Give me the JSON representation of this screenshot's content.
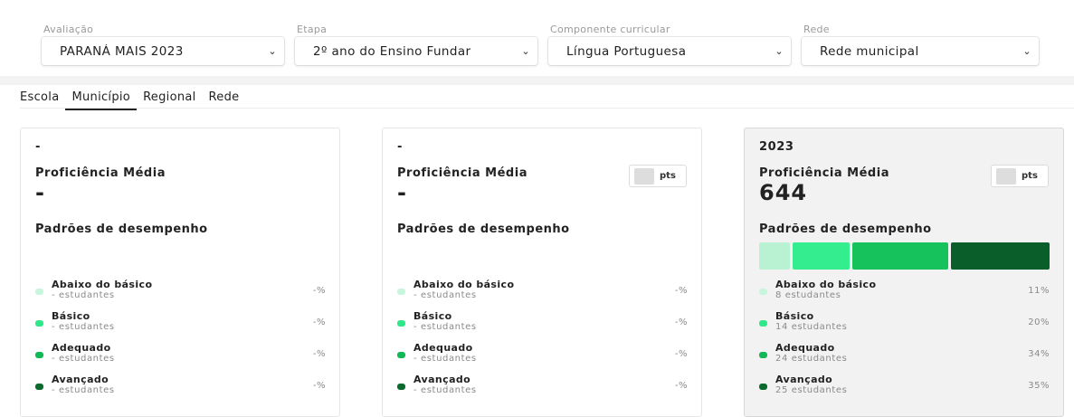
{
  "filters": [
    {
      "label": "Avaliação",
      "value": "PARANÁ MAIS 2023"
    },
    {
      "label": "Etapa",
      "value": "2º ano do Ensino Fundar"
    },
    {
      "label": "Componente curricular",
      "value": "Língua Portuguesa"
    },
    {
      "label": "Rede",
      "value": "Rede municipal"
    }
  ],
  "tabs": [
    "Escola",
    "Município",
    "Regional",
    "Rede"
  ],
  "active_tab": "Município",
  "colors": {
    "abaixo": "#c8f5dd",
    "basico": "#2ee88a",
    "adequado": "#11b855",
    "avancado": "#0b6b2e",
    "bar_abaixo": "#b9f2d3",
    "bar_basico": "#34ed8e",
    "bar_adequado": "#16c25c",
    "bar_avancado": "#0a5e29"
  },
  "cards": [
    {
      "year": "-",
      "proficiency_label": "Proficiência Média",
      "proficiency_value": "-",
      "pts_label": "",
      "levels_title": "Padrões de desempenho",
      "levels": [
        {
          "name": "Abaixo do básico",
          "count": "- estudantes",
          "pct": "-%"
        },
        {
          "name": "Básico",
          "count": "- estudantes",
          "pct": "-%"
        },
        {
          "name": "Adequado",
          "count": "- estudantes",
          "pct": "-%"
        },
        {
          "name": "Avançado",
          "count": "- estudantes",
          "pct": "-%"
        }
      ]
    },
    {
      "year": "-",
      "proficiency_label": "Proficiência Média",
      "proficiency_value": "-",
      "pts_label": "pts",
      "levels_title": "Padrões de desempenho",
      "levels": [
        {
          "name": "Abaixo do básico",
          "count": "- estudantes",
          "pct": "-%"
        },
        {
          "name": "Básico",
          "count": "- estudantes",
          "pct": "-%"
        },
        {
          "name": "Adequado",
          "count": "- estudantes",
          "pct": "-%"
        },
        {
          "name": "Avançado",
          "count": "- estudantes",
          "pct": "-%"
        }
      ]
    },
    {
      "year": "2023",
      "proficiency_label": "Proficiência Média",
      "proficiency_value": "644",
      "pts_label": "pts",
      "levels_title": "Padrões de desempenho",
      "distribution": [
        11,
        20,
        34,
        35
      ],
      "levels": [
        {
          "name": "Abaixo do básico",
          "count": "8 estudantes",
          "pct": "11%"
        },
        {
          "name": "Básico",
          "count": "14 estudantes",
          "pct": "20%"
        },
        {
          "name": "Adequado",
          "count": "24 estudantes",
          "pct": "34%"
        },
        {
          "name": "Avançado",
          "count": "25 estudantes",
          "pct": "35%"
        }
      ]
    }
  ]
}
